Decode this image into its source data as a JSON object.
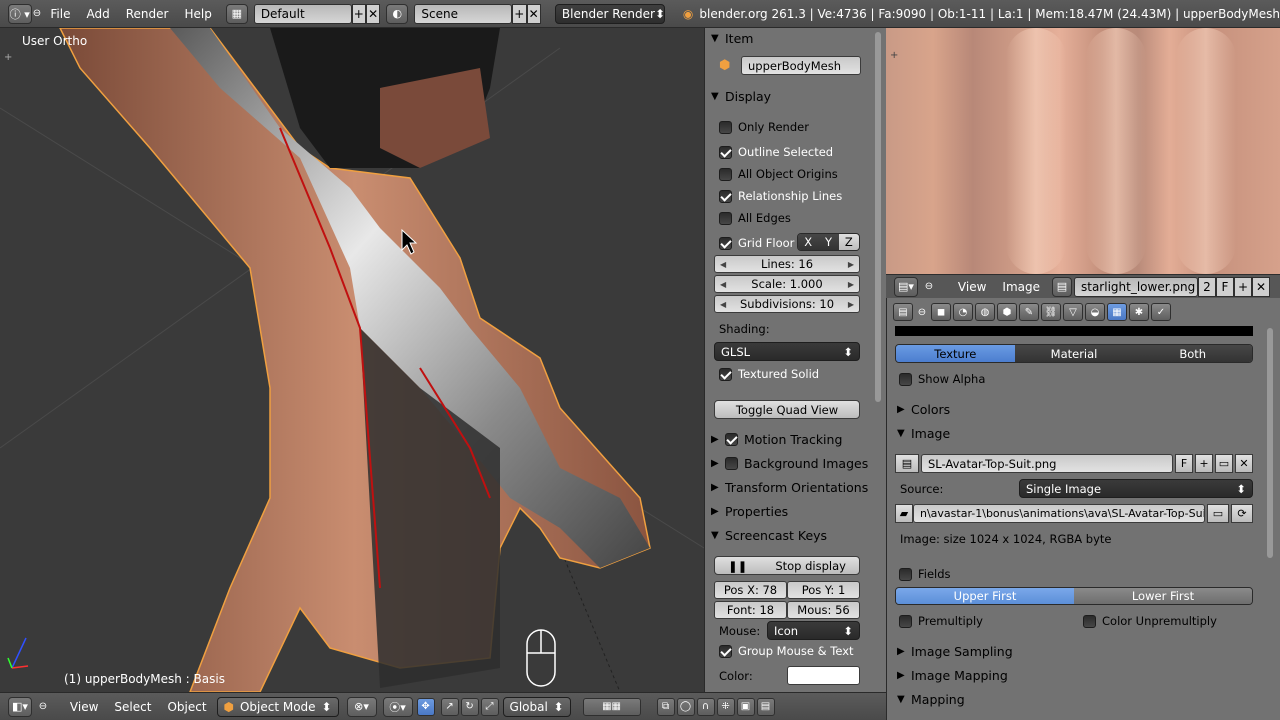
{
  "topbar": {
    "menus": [
      "File",
      "Add",
      "Render",
      "Help"
    ],
    "layout": "Default",
    "scene": "Scene",
    "engine": "Blender Render",
    "stats": "blender.org 261.3 | Ve:4736 | Fa:9090 | Ob:1-11 | La:1 | Mem:18.47M (24.43M) | upperBodyMesh"
  },
  "viewport": {
    "view_label": "User Ortho",
    "object_info": "(1) upperBodyMesh : Basis"
  },
  "props": {
    "item_header": "Item",
    "object_name": "upperBodyMesh",
    "display_header": "Display",
    "only_render": "Only Render",
    "outline_selected": "Outline Selected",
    "all_object_origins": "All Object Origins",
    "relationship_lines": "Relationship Lines",
    "all_edges": "All Edges",
    "grid_floor": "Grid Floor",
    "axis_x": "X",
    "axis_y": "Y",
    "axis_z": "Z",
    "lines": "Lines: 16",
    "scale": "Scale: 1.000",
    "subdivisions": "Subdivisions: 10",
    "shading_label": "Shading:",
    "shading_value": "GLSL",
    "textured_solid": "Textured Solid",
    "toggle_quad": "Toggle Quad View",
    "motion_tracking": "Motion Tracking",
    "background_images": "Background Images",
    "transform_orientations": "Transform Orientations",
    "properties": "Properties",
    "screencast_keys": "Screencast Keys",
    "stop_display": "Stop display",
    "pos_x": "Pos X: 78",
    "pos_y": "Pos Y: 1",
    "font": "Font: 18",
    "mous": "Mous: 56",
    "mouse_label": "Mouse:",
    "mouse_value": "Icon",
    "group_mouse": "Group Mouse & Text",
    "color_label": "Color:"
  },
  "image_editor": {
    "view": "View",
    "image": "Image",
    "filename": "starlight_lower.png",
    "users": "2",
    "fake": "F"
  },
  "texture": {
    "seg_texture": "Texture",
    "seg_material": "Material",
    "seg_both": "Both",
    "show_alpha": "Show Alpha",
    "colors": "Colors",
    "image_header": "Image",
    "image_name": "SL-Avatar-Top-Suit.png",
    "fake": "F",
    "source_label": "Source:",
    "source_value": "Single Image",
    "filepath": "n\\avastar-1\\bonus\\animations\\ava\\SL-Avatar-Top-Suit.png",
    "size_info": "Image: size 1024 x 1024, RGBA byte",
    "fields": "Fields",
    "upper_first": "Upper First",
    "lower_first": "Lower First",
    "premultiply": "Premultiply",
    "color_unpremultiply": "Color Unpremultiply",
    "image_sampling": "Image Sampling",
    "image_mapping": "Image Mapping",
    "mapping": "Mapping"
  },
  "bottombar": {
    "view": "View",
    "select": "Select",
    "object": "Object",
    "mode": "Object Mode",
    "orientation": "Global"
  },
  "colors": {
    "accent_blue": "#5b8bd6",
    "outline_orange": "#f0a040",
    "panel_gray": "#727272"
  }
}
